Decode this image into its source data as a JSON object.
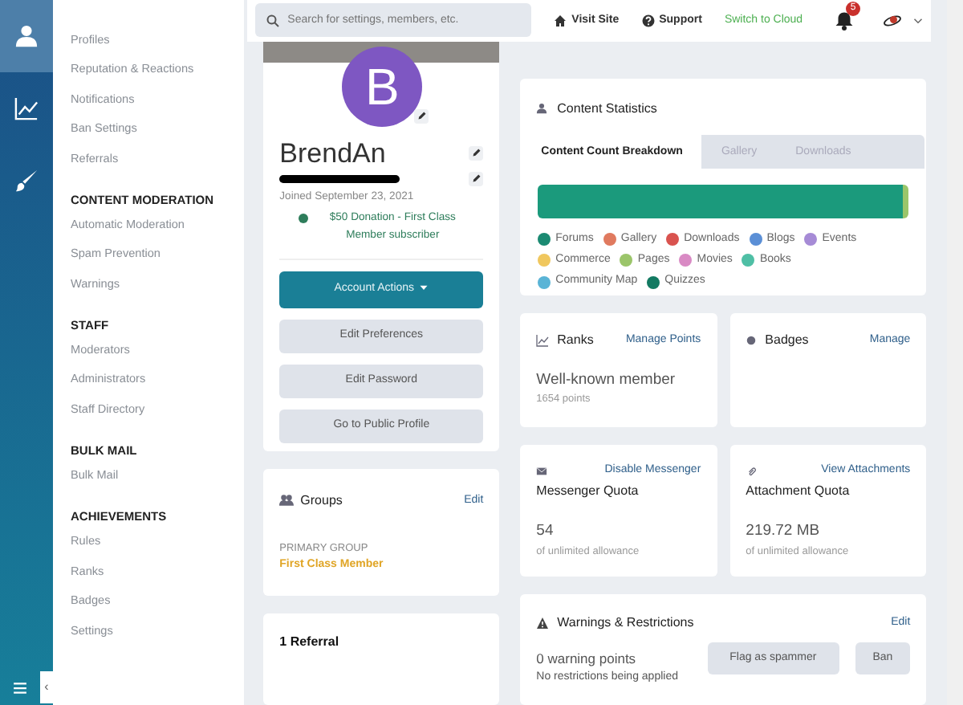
{
  "rail": {
    "items": [
      {
        "kind": "user",
        "selected": true
      },
      {
        "kind": "chart",
        "selected": false
      },
      {
        "kind": "brush",
        "selected": false
      }
    ],
    "collapse_label": "‹"
  },
  "sidebar": {
    "sections": [
      {
        "items": [
          "Profiles",
          "Reputation & Reactions",
          "Notifications",
          "Ban Settings",
          "Referrals"
        ]
      },
      {
        "heading": "CONTENT MODERATION",
        "items": [
          "Automatic Moderation",
          "Spam Prevention",
          "Warnings"
        ]
      },
      {
        "heading": "STAFF",
        "items": [
          "Moderators",
          "Administrators",
          "Staff Directory"
        ]
      },
      {
        "heading": "BULK MAIL",
        "items": [
          "Bulk Mail"
        ]
      },
      {
        "heading": "ACHIEVEMENTS",
        "items": [
          "Rules",
          "Ranks",
          "Badges",
          "Settings"
        ]
      }
    ]
  },
  "topbar": {
    "search": {
      "placeholder": "Search for settings, members, etc."
    },
    "visit_site": "Visit Site",
    "support": "Support",
    "switch": "Switch to Cloud",
    "notification_count": "5"
  },
  "profile": {
    "avatar_letter": "B",
    "name": "BrendAn",
    "joined": "Joined September 23, 2021",
    "subscription": "$50 Donation - First Class Member subscriber",
    "buttons": [
      {
        "label": "Account Actions",
        "kind": "primary"
      },
      {
        "label": "Edit Preferences",
        "kind": "secondary"
      },
      {
        "label": "Edit Password",
        "kind": "secondary"
      },
      {
        "label": "Go to Public Profile",
        "kind": "secondary"
      }
    ]
  },
  "groups": {
    "title": "Groups",
    "edit": "Edit",
    "primary_label": "PRIMARY GROUP",
    "primary_group": "First Class Member"
  },
  "referrals": {
    "title": "1 Referral"
  },
  "content_statistics": {
    "title": "Content Statistics",
    "tabs": [
      {
        "label": "Content Count Breakdown",
        "selected": true
      },
      {
        "label": "Gallery",
        "selected": false
      },
      {
        "label": "Downloads",
        "selected": false
      }
    ],
    "legend": [
      {
        "label": "Forums",
        "color": "#1b8a72"
      },
      {
        "label": "Gallery",
        "color": "#e07a5f"
      },
      {
        "label": "Downloads",
        "color": "#d9534f"
      },
      {
        "label": "Blogs",
        "color": "#5b8fd6"
      },
      {
        "label": "Events",
        "color": "#a68bd6"
      },
      {
        "label": "Commerce",
        "color": "#f0c75e"
      },
      {
        "label": "Pages",
        "color": "#9bc56a"
      },
      {
        "label": "Movies",
        "color": "#d98ac4"
      },
      {
        "label": "Books",
        "color": "#4fbfa5"
      },
      {
        "label": "Community Map",
        "color": "#5ab4d6"
      },
      {
        "label": "Quizzes",
        "color": "#137a62"
      }
    ]
  },
  "ranks": {
    "title": "Ranks",
    "action": "Manage Points",
    "rank": "Well-known member",
    "points": "1654 points"
  },
  "badges": {
    "title": "Badges",
    "action": "Manage"
  },
  "messenger": {
    "action": "Disable Messenger",
    "title": "Messenger Quota",
    "value": "54",
    "note": "of unlimited allowance"
  },
  "attachments": {
    "action": "View Attachments",
    "title": "Attachment Quota",
    "value": "219.72 MB",
    "note": "of unlimited allowance"
  },
  "warnings": {
    "title": "Warnings & Restrictions",
    "edit": "Edit",
    "points": "0 warning points",
    "restrictions": "No restrictions being applied",
    "buttons": [
      "Flag as spammer",
      "Ban"
    ]
  }
}
